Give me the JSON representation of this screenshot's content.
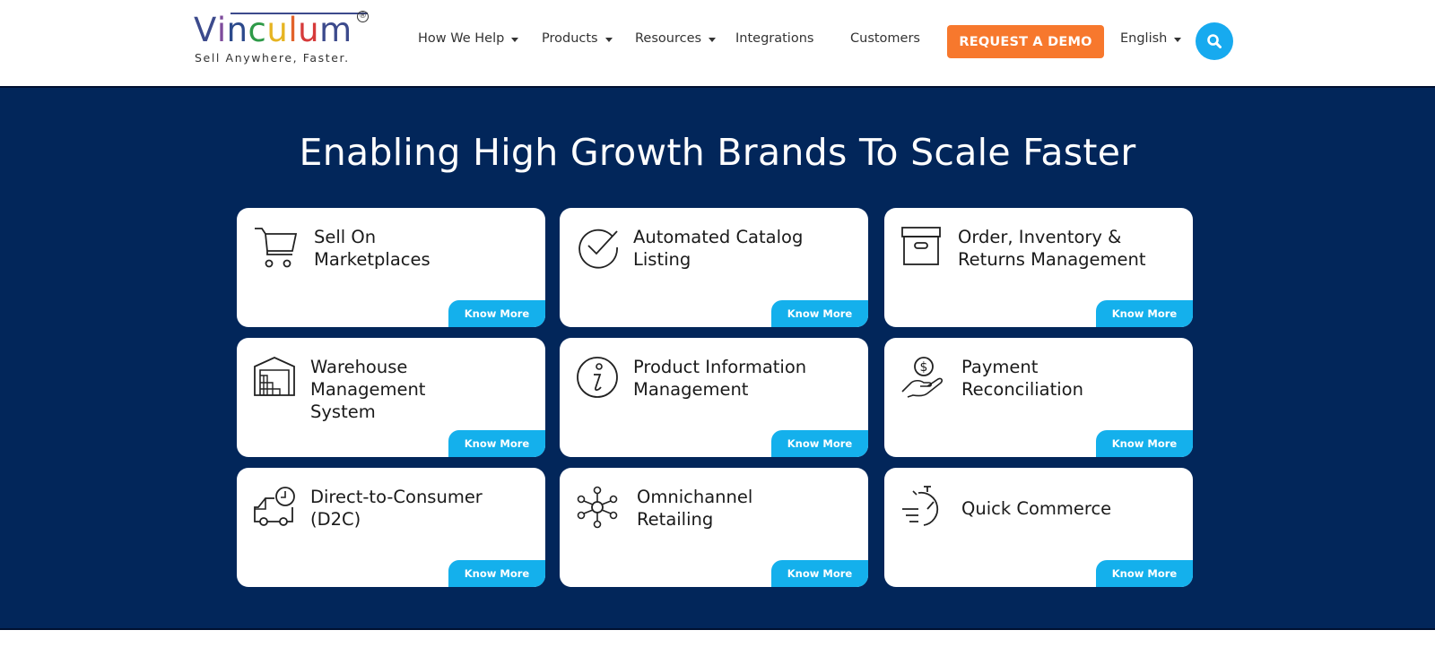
{
  "header": {
    "logo": {
      "letters": [
        {
          "char": "V",
          "color": "#3c4a8c"
        },
        {
          "char": "i",
          "color": "#7e4c9c"
        },
        {
          "char": "n",
          "color": "#2c4a8c"
        },
        {
          "char": "c",
          "color": "#2e9a48"
        },
        {
          "char": "u",
          "color": "#e6b422"
        },
        {
          "char": "l",
          "color": "#e2632b"
        },
        {
          "char": "u",
          "color": "#d63a3a"
        },
        {
          "char": "m",
          "color": "#3c4a8c"
        }
      ],
      "registered": "®",
      "tagline": "Sell Anywhere, Faster."
    },
    "nav": [
      {
        "label": "How We Help",
        "dropdown": true
      },
      {
        "label": "Products",
        "dropdown": true
      },
      {
        "label": "Resources",
        "dropdown": true
      },
      {
        "label": "Integrations",
        "dropdown": false
      },
      {
        "label": "Customers",
        "dropdown": false
      }
    ],
    "cta_label": "REQUEST A DEMO",
    "language": "English",
    "search_icon": "search-icon",
    "colors": {
      "cta": "#f7782d",
      "search": "#17aaef"
    }
  },
  "hero": {
    "title": "Enabling High Growth Brands To Scale Faster",
    "background": "#02265a",
    "cards": [
      {
        "title": "Sell On Marketplaces",
        "lines": [
          "Sell On",
          "Marketplaces"
        ],
        "icon": "shopping-cart-icon",
        "button": "Know More"
      },
      {
        "title": "Automated Catalog Listing",
        "lines": [
          "Automated Catalog",
          "Listing"
        ],
        "icon": "check-circle-icon",
        "button": "Know More"
      },
      {
        "title": "Order, Inventory & Returns Management",
        "lines": [
          "Order, Inventory &",
          "Returns Management"
        ],
        "icon": "archive-box-icon",
        "button": "Know More"
      },
      {
        "title": "Warehouse Management System",
        "lines": [
          "Warehouse",
          "Management",
          "System"
        ],
        "icon": "warehouse-icon",
        "button": "Know More"
      },
      {
        "title": "Product Information Management",
        "lines": [
          "Product Information",
          "Management"
        ],
        "icon": "info-circle-icon",
        "button": "Know More"
      },
      {
        "title": "Payment Reconciliation",
        "lines": [
          "Payment",
          "Reconciliation"
        ],
        "icon": "hand-dollar-coin-icon",
        "button": "Know More"
      },
      {
        "title": "Direct-to-Consumer (D2C)",
        "lines": [
          "Direct-to-Consumer",
          "(D2C)"
        ],
        "icon": "delivery-truck-clock-icon",
        "button": "Know More"
      },
      {
        "title": "Omnichannel Retailing",
        "lines": [
          "Omnichannel",
          "Retailing"
        ],
        "icon": "network-hub-icon",
        "button": "Know More"
      },
      {
        "title": "Quick Commerce",
        "lines": [
          "Quick Commerce"
        ],
        "icon": "fast-stopwatch-icon",
        "button": "Know More"
      }
    ],
    "button_color": "#14b0ec"
  }
}
